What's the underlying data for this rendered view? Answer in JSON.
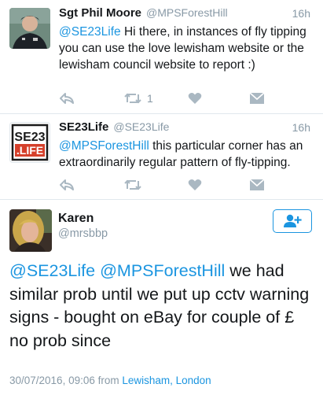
{
  "tweets": [
    {
      "name": "Sgt Phil Moore",
      "handle": "@MPSForestHill",
      "time": "16h",
      "mention": "@SE23Life",
      "text": " Hi there, in instances of fly tipping you can use the love lewisham website or the lewisham council website to report :)",
      "retweets": "1",
      "avatar_icon": "officer-photo"
    },
    {
      "name": "SE23Life",
      "handle": "@SE23Life",
      "time": "16h",
      "mention": "@MPSForestHill",
      "text": " this particular corner has an extraordinarily regular pattern of fly-tipping.",
      "retweets": "",
      "avatar_logo_top": "SE23",
      "avatar_logo_bottom": ".LIFE"
    }
  ],
  "main_tweet": {
    "name": "Karen",
    "handle": "@mrsbbp",
    "mention1": "@SE23Life",
    "mention2": "@MPSForestHill",
    "text": " we had similar prob until we put up cctv warning signs - bought on eBay for couple of £ no prob since",
    "timestamp": "30/07/2016, 09:06 from ",
    "location": "Lewisham, London",
    "follow_icon": "add-user-icon"
  },
  "colors": {
    "accent": "#1b95e0",
    "muted": "#8899a6",
    "icon": "#aab8c2"
  }
}
